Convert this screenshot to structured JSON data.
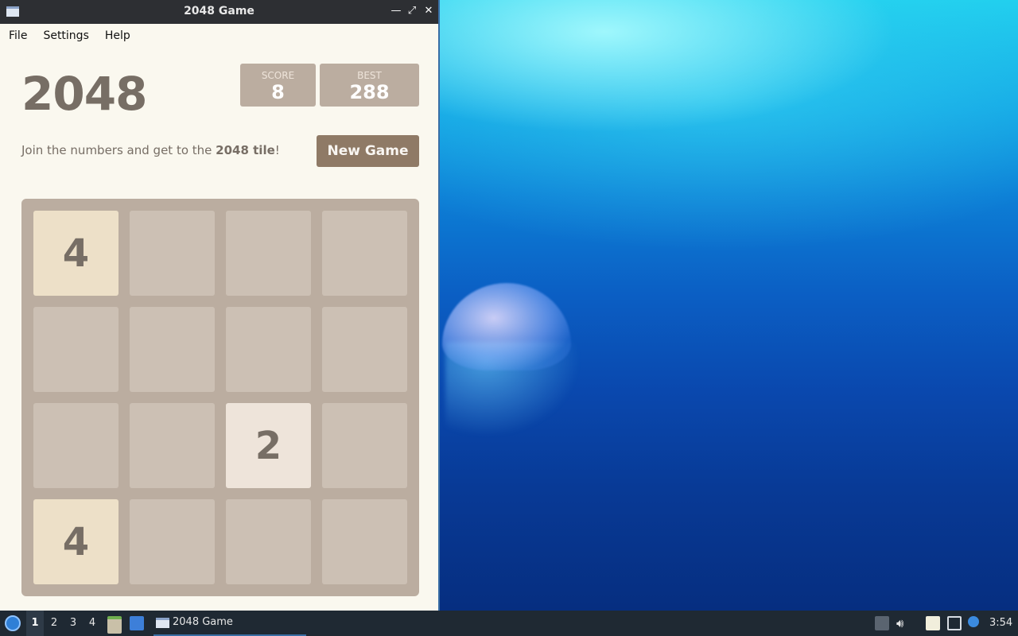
{
  "window": {
    "title": "2048 Game",
    "controls": {
      "minimize": "—",
      "maximize": "⤢",
      "close": "✕"
    }
  },
  "menubar": {
    "items": [
      "File",
      "Settings",
      "Help"
    ]
  },
  "game": {
    "heading": "2048",
    "score": {
      "label": "SCORE",
      "value": "8"
    },
    "best": {
      "label": "BEST",
      "value": "288"
    },
    "intro_prefix": "Join the numbers and get to the ",
    "intro_bold": "2048 tile",
    "intro_suffix": "!",
    "new_game_label": "New Game",
    "board": [
      [
        "4",
        "",
        "",
        ""
      ],
      [
        "",
        "",
        "",
        ""
      ],
      [
        "",
        "",
        "2",
        ""
      ],
      [
        "4",
        "",
        "",
        ""
      ]
    ]
  },
  "taskbar": {
    "workspaces": [
      "1",
      "2",
      "3",
      "4"
    ],
    "active_workspace": "1",
    "task_title": "2048 Game",
    "clock": "3:54",
    "tray_icons": [
      "upload-icon",
      "volume-icon",
      "clipboard-icon",
      "network-icon",
      "notification-icon"
    ]
  },
  "colors": {
    "board_bg": "#bbada0",
    "tile_2": "#eee4da",
    "tile_4": "#ede0c8",
    "text": "#776e65",
    "button": "#8f7a66"
  }
}
